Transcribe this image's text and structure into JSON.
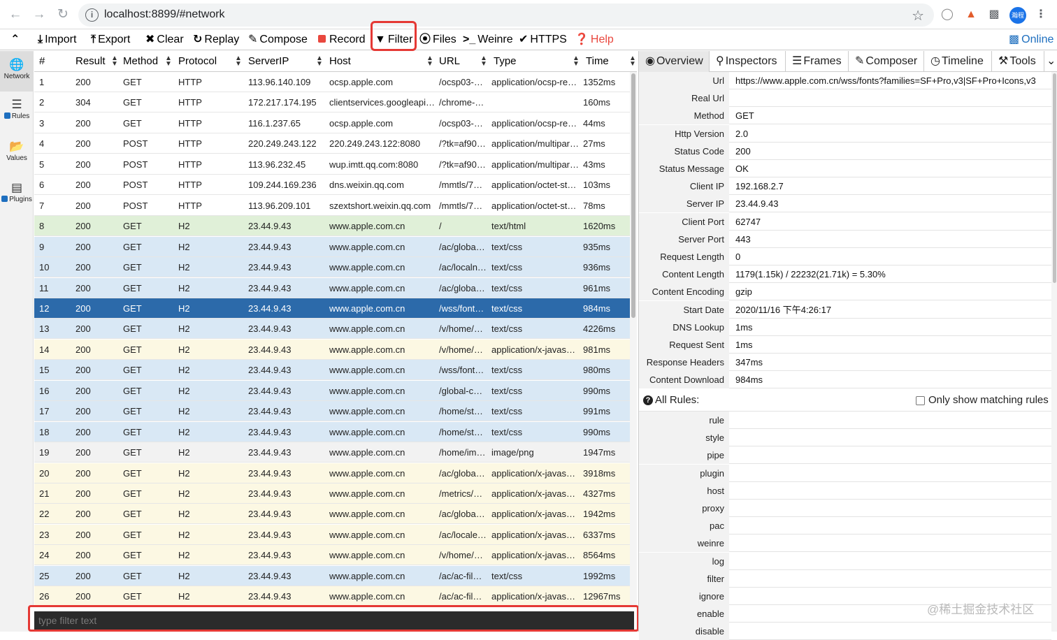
{
  "browser": {
    "url": "localhost:8899/#network",
    "avatar_text": "瀚程"
  },
  "toolbar": {
    "import": "Import",
    "export": "Export",
    "clear": "Clear",
    "replay": "Replay",
    "compose": "Compose",
    "record": "Record",
    "filter": "Filter",
    "files": "Files",
    "weinre": "Weinre",
    "https": "HTTPS",
    "help": "Help",
    "online": "Online"
  },
  "sidebar": {
    "items": [
      {
        "label": "Network",
        "icon": "globe-icon"
      },
      {
        "label": "Rules",
        "icon": "list-icon",
        "checked": true
      },
      {
        "label": "Values",
        "icon": "folder-icon"
      },
      {
        "label": "Plugins",
        "icon": "plugin-icon",
        "checked": true
      }
    ]
  },
  "table": {
    "columns": [
      "#",
      "Result",
      "Method",
      "Protocol",
      "ServerIP",
      "Host",
      "URL",
      "Type",
      "Time"
    ],
    "rows": [
      {
        "id": "1",
        "result": "200",
        "method": "GET",
        "protocol": "HTTP",
        "ip": "113.96.140.109",
        "host": "ocsp.apple.com",
        "url": "/ocsp03-…",
        "type": "application/ocsp-re…",
        "time": "1352ms",
        "color": "white"
      },
      {
        "id": "2",
        "result": "304",
        "method": "GET",
        "protocol": "HTTP",
        "ip": "172.217.174.195",
        "host": "clientservices.googleapi…",
        "url": "/chrome-…",
        "type": "",
        "time": "160ms",
        "color": "white"
      },
      {
        "id": "3",
        "result": "200",
        "method": "GET",
        "protocol": "HTTP",
        "ip": "116.1.237.65",
        "host": "ocsp.apple.com",
        "url": "/ocsp03-…",
        "type": "application/ocsp-re…",
        "time": "44ms",
        "color": "white"
      },
      {
        "id": "4",
        "result": "200",
        "method": "POST",
        "protocol": "HTTP",
        "ip": "220.249.243.122",
        "host": "220.249.243.122:8080",
        "url": "/?tk=af90…",
        "type": "application/multipar…",
        "time": "27ms",
        "color": "white"
      },
      {
        "id": "5",
        "result": "200",
        "method": "POST",
        "protocol": "HTTP",
        "ip": "113.96.232.45",
        "host": "wup.imtt.qq.com:8080",
        "url": "/?tk=af90…",
        "type": "application/multipar…",
        "time": "43ms",
        "color": "white"
      },
      {
        "id": "6",
        "result": "200",
        "method": "POST",
        "protocol": "HTTP",
        "ip": "109.244.169.236",
        "host": "dns.weixin.qq.com",
        "url": "/mmtls/7…",
        "type": "application/octet-st…",
        "time": "103ms",
        "color": "white"
      },
      {
        "id": "7",
        "result": "200",
        "method": "POST",
        "protocol": "HTTP",
        "ip": "113.96.209.101",
        "host": "szextshort.weixin.qq.com",
        "url": "/mmtls/7…",
        "type": "application/octet-st…",
        "time": "78ms",
        "color": "white"
      },
      {
        "id": "8",
        "result": "200",
        "method": "GET",
        "protocol": "H2",
        "ip": "23.44.9.43",
        "host": "www.apple.com.cn",
        "url": "/",
        "type": "text/html",
        "time": "1620ms",
        "color": "green"
      },
      {
        "id": "9",
        "result": "200",
        "method": "GET",
        "protocol": "H2",
        "ip": "23.44.9.43",
        "host": "www.apple.com.cn",
        "url": "/ac/globa…",
        "type": "text/css",
        "time": "935ms",
        "color": "blue"
      },
      {
        "id": "10",
        "result": "200",
        "method": "GET",
        "protocol": "H2",
        "ip": "23.44.9.43",
        "host": "www.apple.com.cn",
        "url": "/ac/localn…",
        "type": "text/css",
        "time": "936ms",
        "color": "blue"
      },
      {
        "id": "11",
        "result": "200",
        "method": "GET",
        "protocol": "H2",
        "ip": "23.44.9.43",
        "host": "www.apple.com.cn",
        "url": "/ac/globa…",
        "type": "text/css",
        "time": "961ms",
        "color": "blue"
      },
      {
        "id": "12",
        "result": "200",
        "method": "GET",
        "protocol": "H2",
        "ip": "23.44.9.43",
        "host": "www.apple.com.cn",
        "url": "/wss/font…",
        "type": "text/css",
        "time": "984ms",
        "color": "selected"
      },
      {
        "id": "13",
        "result": "200",
        "method": "GET",
        "protocol": "H2",
        "ip": "23.44.9.43",
        "host": "www.apple.com.cn",
        "url": "/v/home/…",
        "type": "text/css",
        "time": "4226ms",
        "color": "blue"
      },
      {
        "id": "14",
        "result": "200",
        "method": "GET",
        "protocol": "H2",
        "ip": "23.44.9.43",
        "host": "www.apple.com.cn",
        "url": "/v/home/…",
        "type": "application/x-javas…",
        "time": "981ms",
        "color": "yellow"
      },
      {
        "id": "15",
        "result": "200",
        "method": "GET",
        "protocol": "H2",
        "ip": "23.44.9.43",
        "host": "www.apple.com.cn",
        "url": "/wss/font…",
        "type": "text/css",
        "time": "980ms",
        "color": "blue"
      },
      {
        "id": "16",
        "result": "200",
        "method": "GET",
        "protocol": "H2",
        "ip": "23.44.9.43",
        "host": "www.apple.com.cn",
        "url": "/global-c…",
        "type": "text/css",
        "time": "990ms",
        "color": "blue"
      },
      {
        "id": "17",
        "result": "200",
        "method": "GET",
        "protocol": "H2",
        "ip": "23.44.9.43",
        "host": "www.apple.com.cn",
        "url": "/home/st…",
        "type": "text/css",
        "time": "991ms",
        "color": "blue"
      },
      {
        "id": "18",
        "result": "200",
        "method": "GET",
        "protocol": "H2",
        "ip": "23.44.9.43",
        "host": "www.apple.com.cn",
        "url": "/home/st…",
        "type": "text/css",
        "time": "990ms",
        "color": "blue"
      },
      {
        "id": "19",
        "result": "200",
        "method": "GET",
        "protocol": "H2",
        "ip": "23.44.9.43",
        "host": "www.apple.com.cn",
        "url": "/home/im…",
        "type": "image/png",
        "time": "1947ms",
        "color": "gray"
      },
      {
        "id": "20",
        "result": "200",
        "method": "GET",
        "protocol": "H2",
        "ip": "23.44.9.43",
        "host": "www.apple.com.cn",
        "url": "/ac/globa…",
        "type": "application/x-javas…",
        "time": "3918ms",
        "color": "yellow"
      },
      {
        "id": "21",
        "result": "200",
        "method": "GET",
        "protocol": "H2",
        "ip": "23.44.9.43",
        "host": "www.apple.com.cn",
        "url": "/metrics/…",
        "type": "application/x-javas…",
        "time": "4327ms",
        "color": "yellow"
      },
      {
        "id": "22",
        "result": "200",
        "method": "GET",
        "protocol": "H2",
        "ip": "23.44.9.43",
        "host": "www.apple.com.cn",
        "url": "/ac/globa…",
        "type": "application/x-javas…",
        "time": "1942ms",
        "color": "yellow"
      },
      {
        "id": "23",
        "result": "200",
        "method": "GET",
        "protocol": "H2",
        "ip": "23.44.9.43",
        "host": "www.apple.com.cn",
        "url": "/ac/locale…",
        "type": "application/x-javas…",
        "time": "6337ms",
        "color": "yellow"
      },
      {
        "id": "24",
        "result": "200",
        "method": "GET",
        "protocol": "H2",
        "ip": "23.44.9.43",
        "host": "www.apple.com.cn",
        "url": "/v/home/…",
        "type": "application/x-javas…",
        "time": "8564ms",
        "color": "yellow"
      },
      {
        "id": "25",
        "result": "200",
        "method": "GET",
        "protocol": "H2",
        "ip": "23.44.9.43",
        "host": "www.apple.com.cn",
        "url": "/ac/ac-fil…",
        "type": "text/css",
        "time": "1992ms",
        "color": "blue"
      },
      {
        "id": "26",
        "result": "200",
        "method": "GET",
        "protocol": "H2",
        "ip": "23.44.9.43",
        "host": "www.apple.com.cn",
        "url": "/ac/ac-fil…",
        "type": "application/x-javas…",
        "time": "12967ms",
        "color": "yellow"
      }
    ]
  },
  "filter_input": {
    "placeholder": "type filter text"
  },
  "detail": {
    "tabs": [
      "Overview",
      "Inspectors",
      "Frames",
      "Composer",
      "Timeline",
      "Tools"
    ],
    "overview": [
      {
        "key": "Url",
        "value": "https://www.apple.com.cn/wss/fonts?families=SF+Pro,v3|SF+Pro+Icons,v3"
      },
      {
        "key": "Real Url",
        "value": ""
      },
      {
        "key": "Method",
        "value": "GET"
      },
      {
        "key": "Http Version",
        "value": "2.0"
      },
      {
        "key": "Status Code",
        "value": "200"
      },
      {
        "key": "Status Message",
        "value": "OK"
      },
      {
        "key": "Client IP",
        "value": "192.168.2.7"
      },
      {
        "key": "Server IP",
        "value": "23.44.9.43"
      },
      {
        "key": "Client Port",
        "value": "62747"
      },
      {
        "key": "Server Port",
        "value": "443"
      },
      {
        "key": "Request Length",
        "value": "0"
      },
      {
        "key": "Content Length",
        "value": "1179(1.15k) / 22232(21.71k) = 5.30%"
      },
      {
        "key": "Content Encoding",
        "value": "gzip"
      },
      {
        "key": "Start Date",
        "value": "2020/11/16 下午4:26:17"
      },
      {
        "key": "DNS Lookup",
        "value": "1ms"
      },
      {
        "key": "Request Sent",
        "value": "1ms"
      },
      {
        "key": "Response Headers",
        "value": "347ms"
      },
      {
        "key": "Content Download",
        "value": "984ms"
      }
    ],
    "rules_title": "All Rules:",
    "only_matching_label": "Only show matching rules",
    "rules": [
      "rule",
      "style",
      "pipe",
      "plugin",
      "host",
      "proxy",
      "pac",
      "weinre",
      "log",
      "filter",
      "ignore",
      "enable",
      "disable"
    ]
  },
  "watermark": "@稀土掘金技术社区"
}
